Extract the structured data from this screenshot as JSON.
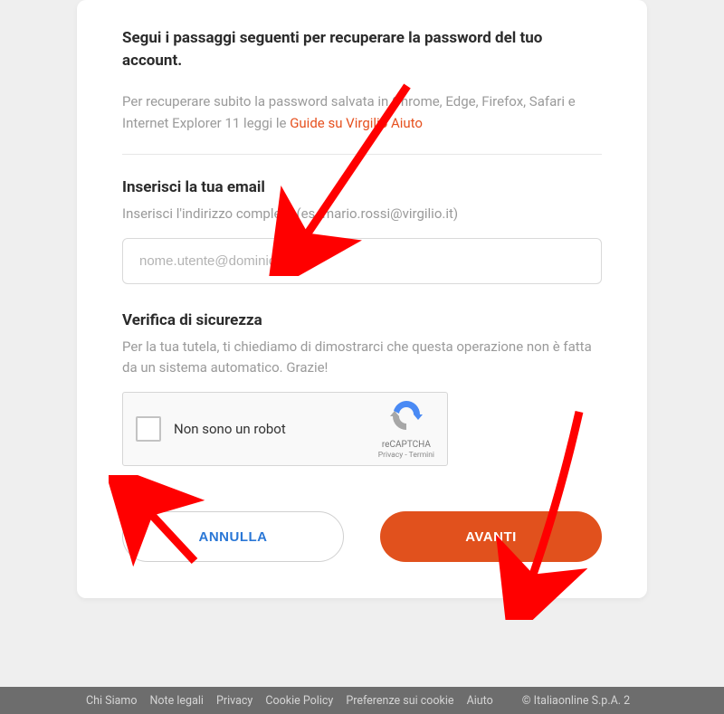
{
  "heading": "Segui i passaggi seguenti per recuperare la password del tuo account.",
  "subtext_before": "Per recuperare subito la password salvata in Chrome, Edge, Firefox, Safari e Internet Explorer 11 leggi le ",
  "subtext_link": "Guide su Virgilio Aiuto",
  "email": {
    "title": "Inserisci la tua email",
    "desc": "Inserisci l'indirizzo completo (es. mario.rossi@virgilio.it)",
    "placeholder": "nome.utente@dominio.it"
  },
  "security": {
    "title": "Verifica di sicurezza",
    "desc": "Per la tua tutela, ti chiediamo di dimostrarci che questa operazione non è fatta da un sistema automatico. Grazie!"
  },
  "recaptcha": {
    "label": "Non sono un robot",
    "brand": "reCAPTCHA",
    "links": "Privacy - Termini"
  },
  "buttons": {
    "cancel": "ANNULLA",
    "next": "AVANTI"
  },
  "footer": {
    "links": [
      "Chi Siamo",
      "Note legali",
      "Privacy",
      "Cookie Policy",
      "Preferenze sui cookie",
      "Aiuto"
    ],
    "copy": "© Italiaonline S.p.A. 2"
  }
}
